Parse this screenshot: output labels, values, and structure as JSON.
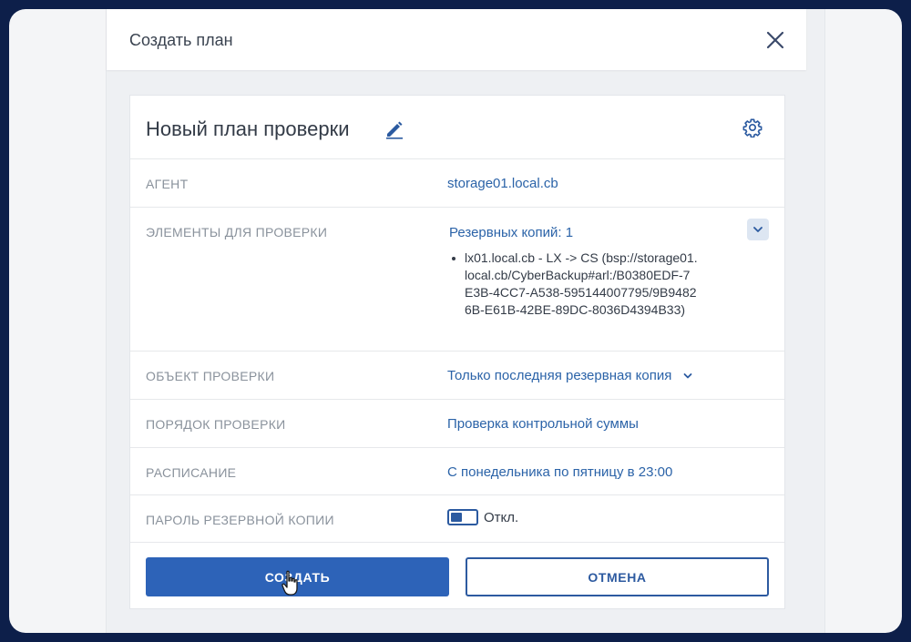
{
  "dialog": {
    "title": "Создать план"
  },
  "plan": {
    "name": "Новый план проверки"
  },
  "rows": {
    "agent": {
      "label": "АГЕНТ",
      "value": "storage01.local.cb"
    },
    "items": {
      "label": "ЭЛЕМЕНТЫ ДЛЯ ПРОВЕРКИ",
      "value": "Резервных копий: 1",
      "list": [
        "lx01.local.cb - LX -> CS (bsp://storage01.local.cb/CyberBackup#arl:/B0380EDF-7E3B-4CC7-A538-595144007795/9B94826B-E61B-42BE-89DC-8036D4394B33)"
      ]
    },
    "object": {
      "label": "ОБЪЕКТ ПРОВЕРКИ",
      "value": "Только последняя резервная копия"
    },
    "order": {
      "label": "ПОРЯДОК ПРОВЕРКИ",
      "value": "Проверка контрольной суммы"
    },
    "schedule": {
      "label": "РАСПИСАНИЕ",
      "value": "С понедельника по пятницу в 23:00"
    },
    "password": {
      "label": "ПАРОЛЬ РЕЗЕРВНОЙ КОПИИ",
      "toggle_text": "Откл."
    }
  },
  "buttons": {
    "create": "СОЗДАТЬ",
    "cancel": "ОТМЕНА"
  },
  "icons": {
    "close": "close-icon",
    "edit": "pencil-icon",
    "settings": "gear-icon",
    "expand": "chevron-down-icon",
    "cursor": "hand-pointer-icon"
  },
  "colors": {
    "accent": "#2d63b8",
    "link": "#2b63a8",
    "background": "#0d1f4a"
  }
}
